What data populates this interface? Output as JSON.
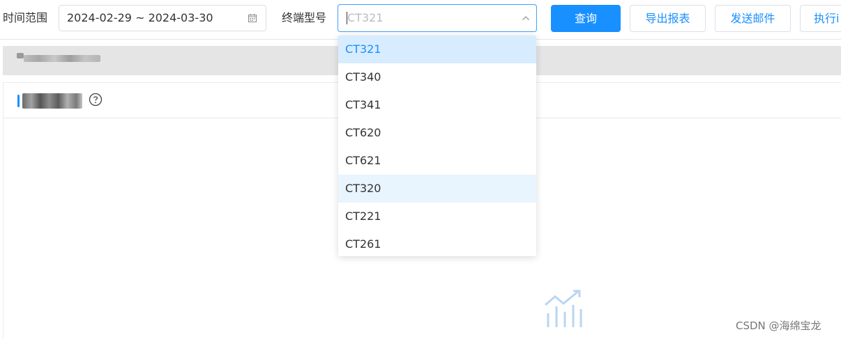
{
  "toolbar": {
    "time_range_label": "时间范围",
    "date_range": "2024-02-29 ~ 2024-03-30",
    "terminal_model_label": "终端型号",
    "terminal_model_placeholder": "CT321",
    "query_label": "查询",
    "export_label": "导出报表",
    "send_email_label": "发送邮件",
    "execute_label": "执行i"
  },
  "dropdown": {
    "options": [
      "CT321",
      "CT340",
      "CT341",
      "CT620",
      "CT621",
      "CT320",
      "CT221",
      "CT261"
    ],
    "selected_index": 0,
    "hover_index": 5
  },
  "watermark": "CSDN @海绵宝龙",
  "icons": {
    "date": "calendar-icon",
    "select": "chevron-up-icon",
    "help": "help-circle-icon",
    "empty_chart": "chart-empty-icon"
  },
  "colors": {
    "primary": "#1890ff",
    "selected_bg": "#d8ecff",
    "hover_bg": "#e8f4fe",
    "placeholder": "#b8bcc4"
  }
}
